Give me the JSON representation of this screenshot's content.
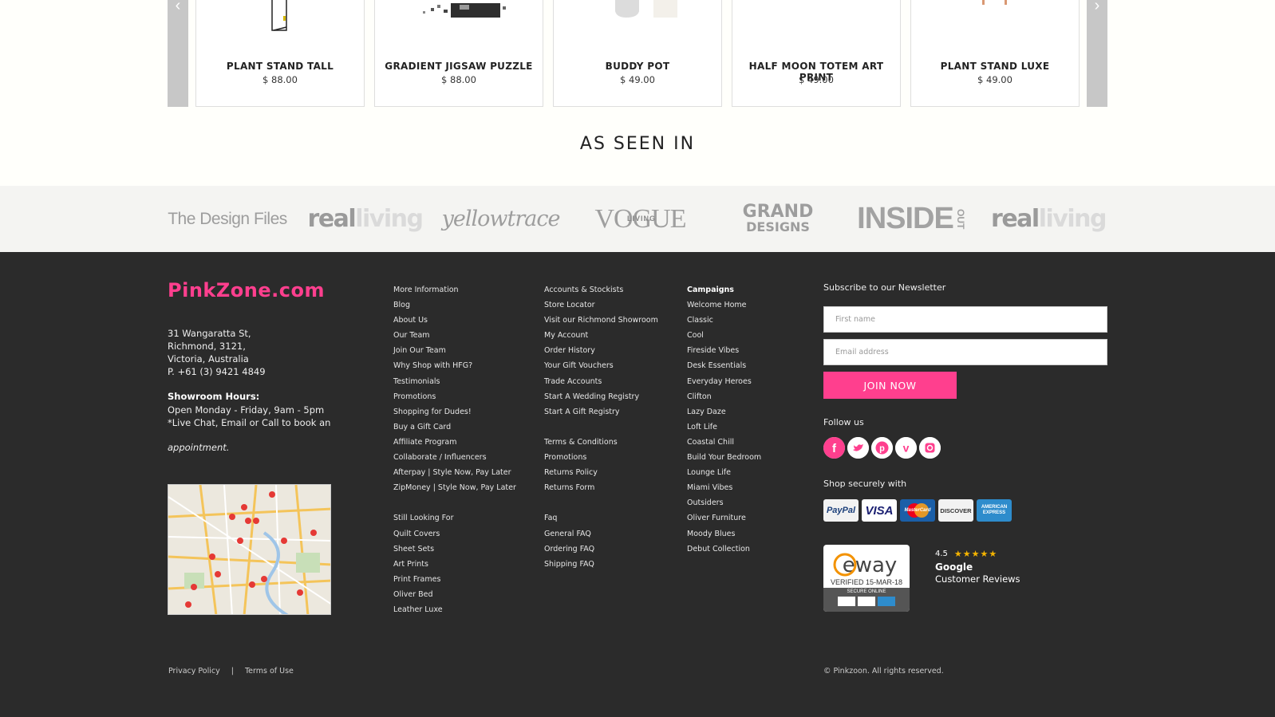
{
  "products": [
    {
      "name": "PLANT STAND TALL",
      "price": "$ 88.00"
    },
    {
      "name": "GRADIENT JIGSAW PUZZLE",
      "price": "$ 88.00"
    },
    {
      "name": "BUDDY POT",
      "price": "$ 49.00"
    },
    {
      "name": "HALF MOON TOTEM ART PRINT",
      "price": "$ 49.00"
    },
    {
      "name": "PLANT STAND LUXE",
      "price": "$ 49.00"
    }
  ],
  "as_seen_in": {
    "title": "AS SEEN IN",
    "logos": {
      "design_files": "The Design Files",
      "real": "real",
      "living": "living",
      "yellowtrace": "yellowtrace",
      "vogue": "VOGUE",
      "vogue_living": "LIVING",
      "grand": "GRAND",
      "designs": "DESIGNS",
      "inside": "INSIDE",
      "out": "OUT"
    }
  },
  "footer": {
    "brand": "PinkZone.com",
    "address": [
      "31 Wangaratta St,",
      "Richmond, 3121,",
      "Victoria, Australia",
      "P.  +61 (3) 9421 4849"
    ],
    "hours_title": "Showroom Hours:",
    "hours": [
      "Open Monday - Friday, 9am - 5pm",
      "*Live Chat, Email or Call to book an"
    ],
    "appointment": "appointment.",
    "col1": [
      "More Information",
      "Blog",
      "About Us",
      "Our Team",
      "Join Our Team",
      "Why Shop with HFG?",
      "Testimonials",
      "Promotions",
      "Shopping for Dudes!",
      "Buy a Gift Card",
      "Affiliate Program",
      "Collaborate / Influencers",
      "Afterpay | Style Now, Pay Later",
      "ZipMoney | Style Now, Pay Later"
    ],
    "col1b": [
      "Still Looking For",
      "Quilt Covers",
      "Sheet Sets",
      "Art Prints",
      "Print Frames",
      "Oliver Bed",
      "Leather Luxe"
    ],
    "col2": [
      "Accounts & Stockists",
      "Store Locator",
      "Visit our Richmond Showroom",
      "My Account",
      "Order History",
      "Your Gift Vouchers",
      "Trade Accounts",
      "Start A Wedding Registry",
      "Start A Gift Registry"
    ],
    "col2b": [
      "Terms & Conditions",
      "Promotions",
      "Returns Policy",
      "Returns Form"
    ],
    "col2c": [
      "Faq",
      "General FAQ",
      "Ordering FAQ",
      "Shipping FAQ"
    ],
    "col3_title": "Campaigns",
    "col3": [
      "Welcome Home",
      "Classic",
      "Cool",
      "Fireside Vibes",
      "Desk Essentials",
      "Everyday Heroes",
      "Clifton",
      "Lazy Daze",
      "Loft Life",
      "Coastal Chill",
      "Build Your Bedroom",
      "Lounge Life",
      "Miami Vibes",
      "Outsiders",
      "Oliver Furniture",
      "Moody Blues",
      "Debut Collection"
    ],
    "newsletter_title": "Subscribe to our Newsletter",
    "first_name_placeholder": "First name",
    "email_placeholder": "Email address",
    "join_label": "JOIN NOW",
    "follow_title": "Follow us",
    "social": [
      "facebook-icon",
      "twitter-icon",
      "pinterest-icon",
      "vimeo-icon",
      "instagram-icon"
    ],
    "secure_title": "Shop securely with",
    "cards": {
      "paypal": "PayPal",
      "visa": "VISA",
      "mastercard": "MasterCard",
      "discover": "DISCOVER",
      "amex": "AMERICAN EXPRESS"
    },
    "eway": {
      "logo": "eway",
      "verified": "VERIFIED 15-MAR-18",
      "secure": "SECURE ONLINE"
    },
    "google": {
      "rating": "4.5",
      "stars": 4.5,
      "name": "Google",
      "label": "Customer Reviews"
    },
    "privacy": "Privacy Policy",
    "separator": "|",
    "terms": "Terms of Use",
    "copyright": "© Pinkzoon. All rights reserved."
  },
  "colors": {
    "accent": "#ff3f8e",
    "footer_bg": "#2b2b2b",
    "star": "#f5b400"
  }
}
